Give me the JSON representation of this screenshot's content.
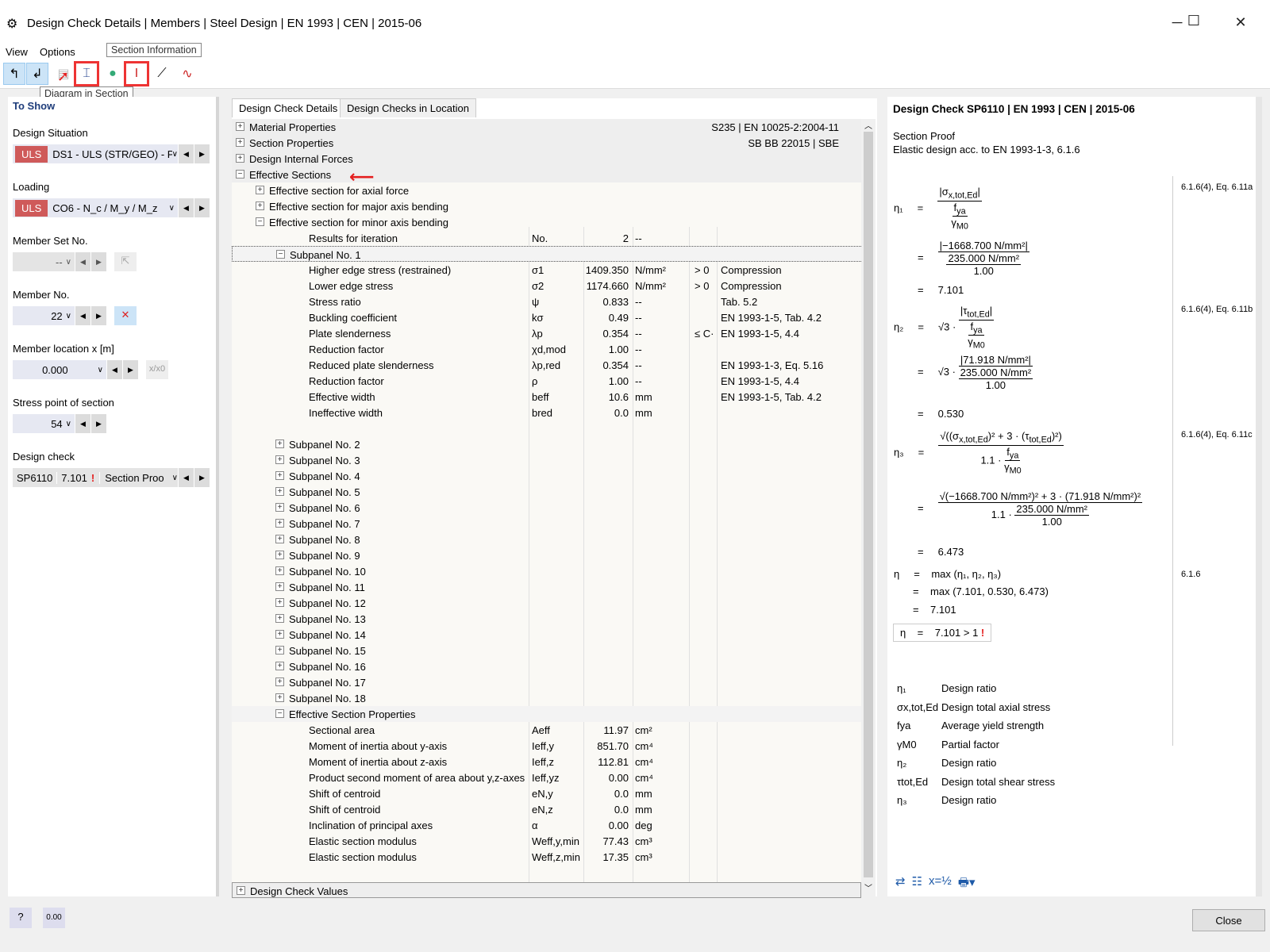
{
  "window": {
    "title": "Design Check Details | Members | Steel Design | EN 1993 | CEN | 2015-06"
  },
  "menu": [
    "View",
    "Options"
  ],
  "tooltips": {
    "section_info": "Section Information",
    "diagram": "Diagram in Section"
  },
  "left": {
    "header": "To Show",
    "design_situation": {
      "label": "Design Situation",
      "badge": "ULS",
      "value": "DS1 - ULS (STR/GEO) - Pe"
    },
    "loading": {
      "label": "Loading",
      "badge": "ULS",
      "value": "CO6 - N_c / M_y / M_z"
    },
    "member_set": {
      "label": "Member Set No.",
      "value": "--"
    },
    "member": {
      "label": "Member No.",
      "value": "22"
    },
    "location": {
      "label": "Member location x [m]",
      "value": "0.000",
      "btn": "x/x0"
    },
    "stress_point": {
      "label": "Stress point of section",
      "value": "54"
    },
    "design_check": {
      "label": "Design check",
      "id": "SP6110",
      "ratio": "7.101",
      "type": "Section Proo"
    }
  },
  "tabs": [
    "Design Check Details",
    "Design Checks in Location"
  ],
  "tree": [
    {
      "lv": 0,
      "e": "+",
      "label": "Material Properties",
      "right": "S235 | EN 10025-2:2004-11",
      "cls": "head"
    },
    {
      "lv": 0,
      "e": "+",
      "label": "Section Properties",
      "right": "SB BB 22015 | SBE",
      "cls": "head"
    },
    {
      "lv": 0,
      "e": "+",
      "label": "Design Internal Forces",
      "cls": "head"
    },
    {
      "lv": 0,
      "e": "-",
      "label": "Effective Sections",
      "cls": "head"
    },
    {
      "lv": 1,
      "e": "+",
      "label": "Effective section for axial force"
    },
    {
      "lv": 1,
      "e": "+",
      "label": "Effective section for major axis bending"
    },
    {
      "lv": 1,
      "e": "-",
      "label": "Effective section for minor axis bending"
    },
    {
      "lv": 2,
      "label": "Results for iteration",
      "sym": "No.",
      "val": "2",
      "unit": "--"
    },
    {
      "lv": 2,
      "e": "-",
      "label": "Subpanel No. 1",
      "cls": "group"
    },
    {
      "lv": 3,
      "label": "Higher edge stress (restrained)",
      "sym": "σ1",
      "val": "1409.350",
      "unit": "N/mm²",
      "cond": "> 0",
      "ref": "Compression"
    },
    {
      "lv": 3,
      "label": "Lower edge stress",
      "sym": "σ2",
      "val": "1174.660",
      "unit": "N/mm²",
      "cond": "> 0",
      "ref": "Compression"
    },
    {
      "lv": 3,
      "label": "Stress ratio",
      "sym": "ψ",
      "val": "0.833",
      "unit": "--",
      "ref": "Tab. 5.2"
    },
    {
      "lv": 3,
      "label": "Buckling coefficient",
      "sym": "kσ",
      "val": "0.49",
      "unit": "--",
      "ref": "EN 1993-1-5, Tab. 4.2"
    },
    {
      "lv": 3,
      "label": "Plate slenderness",
      "sym": "λp",
      "val": "0.354",
      "unit": "--",
      "cond": "≤ C·",
      "ref": "EN 1993-1-5, 4.4"
    },
    {
      "lv": 3,
      "label": "Reduction factor",
      "sym": "χd,mod",
      "val": "1.00",
      "unit": "--"
    },
    {
      "lv": 3,
      "label": "Reduced plate slenderness",
      "sym": "λp,red",
      "val": "0.354",
      "unit": "--",
      "ref": "EN 1993-1-3, Eq. 5.16"
    },
    {
      "lv": 3,
      "label": "Reduction factor",
      "sym": "ρ",
      "val": "1.00",
      "unit": "--",
      "ref": "EN 1993-1-5, 4.4"
    },
    {
      "lv": 3,
      "label": "Effective width",
      "sym": "beff",
      "val": "10.6",
      "unit": "mm",
      "ref": "EN 1993-1-5, Tab. 4.2"
    },
    {
      "lv": 3,
      "label": "Ineffective width",
      "sym": "bred",
      "val": "0.0",
      "unit": "mm"
    },
    {
      "lv": 2,
      "label": "",
      "cls": "blank"
    },
    {
      "lv": 2,
      "e": "+",
      "label": "Subpanel No. 2"
    },
    {
      "lv": 2,
      "e": "+",
      "label": "Subpanel No. 3"
    },
    {
      "lv": 2,
      "e": "+",
      "label": "Subpanel No. 4"
    },
    {
      "lv": 2,
      "e": "+",
      "label": "Subpanel No. 5"
    },
    {
      "lv": 2,
      "e": "+",
      "label": "Subpanel No. 6"
    },
    {
      "lv": 2,
      "e": "+",
      "label": "Subpanel No. 7"
    },
    {
      "lv": 2,
      "e": "+",
      "label": "Subpanel No. 8"
    },
    {
      "lv": 2,
      "e": "+",
      "label": "Subpanel No. 9"
    },
    {
      "lv": 2,
      "e": "+",
      "label": "Subpanel No. 10"
    },
    {
      "lv": 2,
      "e": "+",
      "label": "Subpanel No. 11"
    },
    {
      "lv": 2,
      "e": "+",
      "label": "Subpanel No. 12"
    },
    {
      "lv": 2,
      "e": "+",
      "label": "Subpanel No. 13"
    },
    {
      "lv": 2,
      "e": "+",
      "label": "Subpanel No. 14"
    },
    {
      "lv": 2,
      "e": "+",
      "label": "Subpanel No. 15"
    },
    {
      "lv": 2,
      "e": "+",
      "label": "Subpanel No. 16"
    },
    {
      "lv": 2,
      "e": "+",
      "label": "Subpanel No. 17"
    },
    {
      "lv": 2,
      "e": "+",
      "label": "Subpanel No. 18"
    },
    {
      "lv": 2,
      "e": "-",
      "label": "Effective Section Properties",
      "cls": "group"
    },
    {
      "lv": 3,
      "label": "Sectional area",
      "sym": "Aeff",
      "val": "11.97",
      "unit": "cm²"
    },
    {
      "lv": 3,
      "label": "Moment of inertia about y-axis",
      "sym": "Ieff,y",
      "val": "851.70",
      "unit": "cm⁴"
    },
    {
      "lv": 3,
      "label": "Moment of inertia about z-axis",
      "sym": "Ieff,z",
      "val": "112.81",
      "unit": "cm⁴"
    },
    {
      "lv": 3,
      "label": "Product second moment of area about y,z-axes",
      "sym": "Ieff,yz",
      "val": "0.00",
      "unit": "cm⁴"
    },
    {
      "lv": 3,
      "label": "Shift of centroid",
      "sym": "eN,y",
      "val": "0.0",
      "unit": "mm"
    },
    {
      "lv": 3,
      "label": "Shift of centroid",
      "sym": "eN,z",
      "val": "0.0",
      "unit": "mm"
    },
    {
      "lv": 3,
      "label": "Inclination of principal axes",
      "sym": "α",
      "val": "0.00",
      "unit": "deg"
    },
    {
      "lv": 3,
      "label": "Elastic section modulus",
      "sym": "Weff,y,min",
      "val": "77.43",
      "unit": "cm³"
    },
    {
      "lv": 3,
      "label": "Elastic section modulus",
      "sym": "Weff,z,min",
      "val": "17.35",
      "unit": "cm³"
    }
  ],
  "footer_row": "Design Check Values",
  "right": {
    "title": "Design Check SP6110 | EN 1993 | CEN | 2015-06",
    "sub1": "Section Proof",
    "sub2": "Elastic design acc. to EN 1993-1-3, 6.1.6",
    "refs": [
      "6.1.6(4), Eq. 6.11a",
      "6.1.6(4), Eq. 6.11b",
      "6.1.6(4), Eq. 6.11c",
      "6.1.6"
    ],
    "eta1": {
      "num": "|−1668.700 N/mm²|",
      "den": "235.000 N/mm²",
      "gm": "1.00",
      "res": "7.101"
    },
    "eta2": {
      "num": "|71.918 N/mm²|",
      "den": "235.000 N/mm²",
      "gm": "1.00",
      "res": "0.530"
    },
    "eta3": {
      "num": "(−1668.700 N/mm²)² + 3 · (71.918 N/mm²)²",
      "den": "235.000 N/mm²",
      "gm": "1.00",
      "res": "6.473"
    },
    "max": {
      "expr": "max (η₁, η₂, η₃)",
      "vals": "max (7.101, 0.530, 6.473)",
      "res": "7.101"
    },
    "final": "7.101  > 1",
    "legend": [
      {
        "sym": "η₁",
        "text": "Design ratio"
      },
      {
        "sym": "σx,tot,Ed",
        "text": "Design total axial stress"
      },
      {
        "sym": "fya",
        "text": "Average yield strength"
      },
      {
        "sym": "γM0",
        "text": "Partial factor"
      },
      {
        "sym": "η₂",
        "text": "Design ratio"
      },
      {
        "sym": "τtot,Ed",
        "text": "Design total shear stress"
      },
      {
        "sym": "η₃",
        "text": "Design ratio"
      }
    ]
  },
  "bottom": {
    "close": "Close"
  }
}
